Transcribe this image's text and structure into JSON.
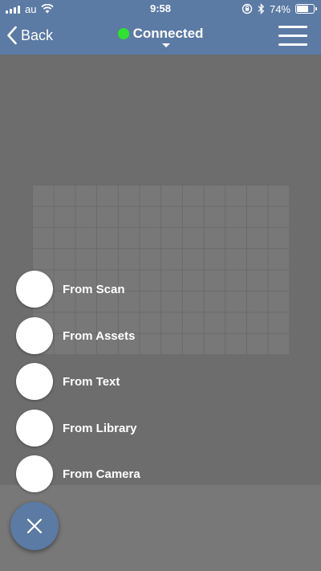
{
  "status_bar": {
    "carrier": "au",
    "time": "9:58",
    "battery_percent_text": "74%",
    "battery_level": 0.74,
    "icons": [
      "signal-icon",
      "wifi-icon",
      "orientation-lock-icon",
      "bluetooth-icon",
      "battery-icon"
    ]
  },
  "nav": {
    "back_label": "Back",
    "connection_label": "Connected",
    "connection_status_color": "#2ee32e",
    "icons": [
      "chevron-left-icon",
      "status-dot-icon",
      "caret-down-icon",
      "hamburger-menu-icon"
    ]
  },
  "actions": [
    {
      "label": "From Scan"
    },
    {
      "label": "From Assets"
    },
    {
      "label": "From Text"
    },
    {
      "label": "From Library"
    },
    {
      "label": "From Camera"
    }
  ],
  "fab": {
    "icon": "close-icon"
  },
  "colors": {
    "accent": "#5b7aa4",
    "overlay": "#6d6d6d",
    "panel": "#787878"
  }
}
